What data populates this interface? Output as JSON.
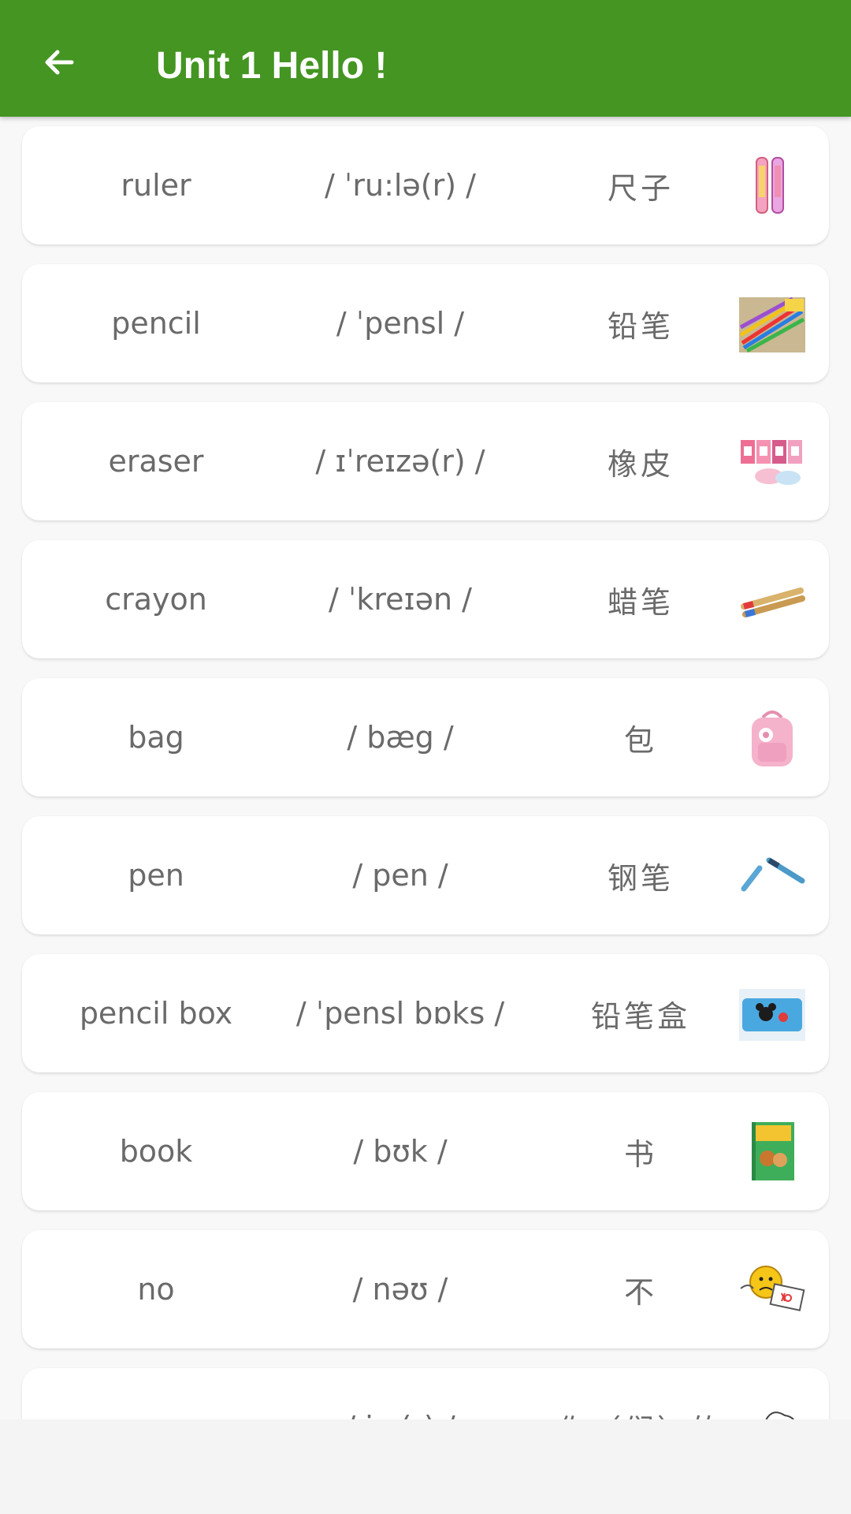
{
  "appbar": {
    "title": "Unit 1 Hello !",
    "back_icon": "arrow-left-icon",
    "color": "#449522"
  },
  "words": [
    {
      "word": "ruler",
      "phonetic": "/ ˈru:lə(r) /",
      "chinese": "尺子",
      "image": "ruler-image"
    },
    {
      "word": "pencil",
      "phonetic": "/ ˈpensl /",
      "chinese": "铅笔",
      "image": "pencils-image"
    },
    {
      "word": "eraser",
      "phonetic": "/ ɪˈreɪzə(r) /",
      "chinese": "橡皮",
      "image": "erasers-image"
    },
    {
      "word": "crayon",
      "phonetic": "/ ˈkreɪən /",
      "chinese": "蜡笔",
      "image": "crayons-image"
    },
    {
      "word": "bag",
      "phonetic": "/ bæg /",
      "chinese": "包",
      "image": "backpack-image"
    },
    {
      "word": "pen",
      "phonetic": "/ pen /",
      "chinese": "钢笔",
      "image": "fountain-pen-image"
    },
    {
      "word": "pencil box",
      "phonetic": "/ ˈpensl bɒks /",
      "chinese": "铅笔盒",
      "image": "pencil-box-image"
    },
    {
      "word": "book",
      "phonetic": "/ bʊk /",
      "chinese": "书",
      "image": "book-image"
    },
    {
      "word": "no",
      "phonetic": "/ nəʊ /",
      "chinese": "不",
      "image": "no-emoji-image"
    },
    {
      "word": "your",
      "phonetic": "/ jɔ:(r) /",
      "chinese": "你（们）的",
      "image": "your-image"
    }
  ]
}
